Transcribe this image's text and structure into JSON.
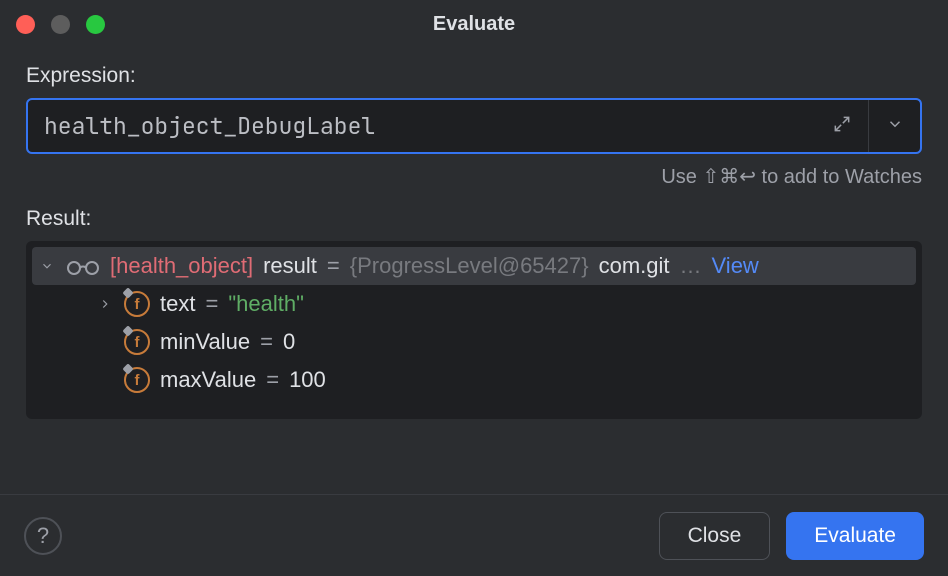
{
  "window": {
    "title": "Evaluate"
  },
  "expression": {
    "label": "Expression:",
    "value": "health_object_DebugLabel"
  },
  "hint": "Use ⇧⌘↩ to add to Watches",
  "result": {
    "label": "Result:",
    "root": {
      "labelTag": "[health_object]",
      "name": "result",
      "equals": "=",
      "objectRef": "{ProgressLevel@65427}",
      "summary": "com.git",
      "ellipsis": "…",
      "viewLink": "View"
    },
    "fields": [
      {
        "name": "text",
        "equals": "=",
        "value": "\"health\"",
        "valueKind": "string",
        "expandable": true
      },
      {
        "name": "minValue",
        "equals": "=",
        "value": "0",
        "valueKind": "number",
        "expandable": false
      },
      {
        "name": "maxValue",
        "equals": "=",
        "value": "100",
        "valueKind": "number",
        "expandable": false
      }
    ]
  },
  "footer": {
    "close": "Close",
    "evaluate": "Evaluate"
  }
}
